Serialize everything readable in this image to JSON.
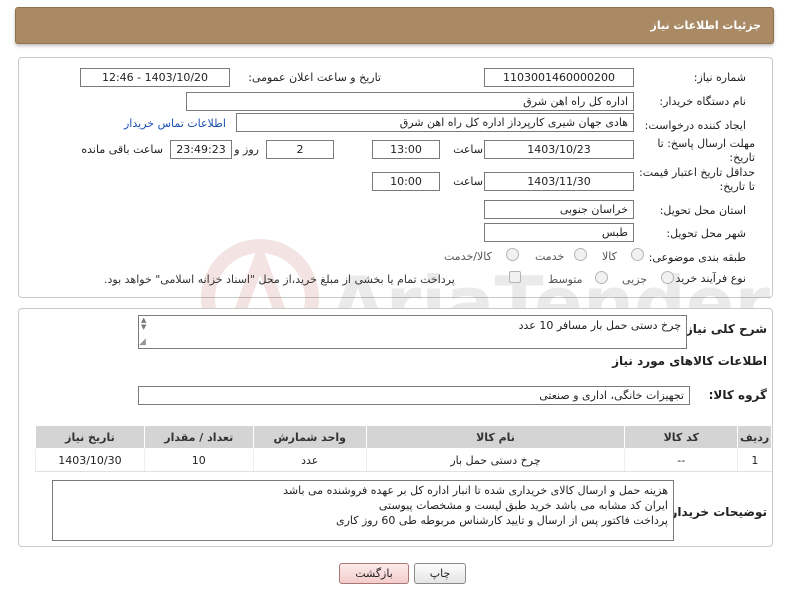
{
  "header": {
    "title": "جزئیات اطلاعات نیاز"
  },
  "form": {
    "need_number_label": "شماره نیاز:",
    "need_number": "1103001460000200",
    "announce_label": "تاریخ و ساعت اعلان عمومی:",
    "announce_value": "1403/10/20 - 12:46",
    "buyer_org_label": "نام دستگاه خریدار:",
    "buyer_org": "اداره کل راه اهن شرق",
    "requester_label": "ایجاد کننده درخواست:",
    "requester": "هادی جهان شیری کارپرداز اداره کل راه اهن شرق",
    "contact_link": "اطلاعات تماس خریدار",
    "reply_deadline_label": "مهلت ارسال پاسخ: تا تاریخ:",
    "reply_date": "1403/10/23",
    "time_label": "ساعت",
    "reply_time": "13:00",
    "days_value": "2",
    "days_label": "روز و",
    "remaining_time": "23:49:23",
    "remaining_label": "ساعت باقی مانده",
    "validity_label": "حداقل تاریخ اعتبار قیمت: تا تاریخ:",
    "validity_date": "1403/11/30",
    "validity_time": "10:00",
    "province_label": "استان محل تحویل:",
    "province": "خراسان جنوبی",
    "city_label": "شهر محل تحویل:",
    "city": "طبس",
    "category_label": "طبقه بندی موضوعی:",
    "category_options": [
      "کالا",
      "خدمت",
      "کالا/خدمت"
    ],
    "process_label": "نوع فرآیند خرید :",
    "process_options": [
      "جزیی",
      "متوسط"
    ],
    "payment_note": "پرداخت تمام یا بخشی از مبلغ خرید،از محل \"اسناد خزانه اسلامی\" خواهد بود."
  },
  "summary": {
    "label": "شرح کلی نیاز:",
    "value": "چرخ دستی حمل بار مسافر     10 عدد"
  },
  "goods": {
    "section_title": "اطلاعات کالاهای مورد نیاز",
    "group_label": "گروه کالا:",
    "group_value": "تجهیزات خانگی، اداری و صنعتی",
    "columns": [
      "ردیف",
      "کد کالا",
      "نام کالا",
      "واحد شمارش",
      "تعداد / مقدار",
      "تاریخ نیاز"
    ],
    "rows": [
      [
        "1",
        "--",
        "چرخ دستی حمل بار",
        "عدد",
        "10",
        "1403/10/30"
      ]
    ]
  },
  "buyer_notes": {
    "label": "توضیحات خریدار:",
    "text": "هزینه حمل و ارسال کالای خریداری شده تا انبار اداره کل بر عهده فروشنده می باشد\nایران کد مشابه می باشد خرید طبق لیست و مشخصات پیوستی\nپرداخت فاکتور پس از ارسال و تایید کارشناس مربوطه طی 60 روز کاری"
  },
  "buttons": {
    "print": "چاپ",
    "back": "بازگشت"
  },
  "watermark": {
    "text": "AriaTender.neT"
  },
  "colors": {
    "header_bg": "#a98a64",
    "link": "#1a4fb3"
  }
}
